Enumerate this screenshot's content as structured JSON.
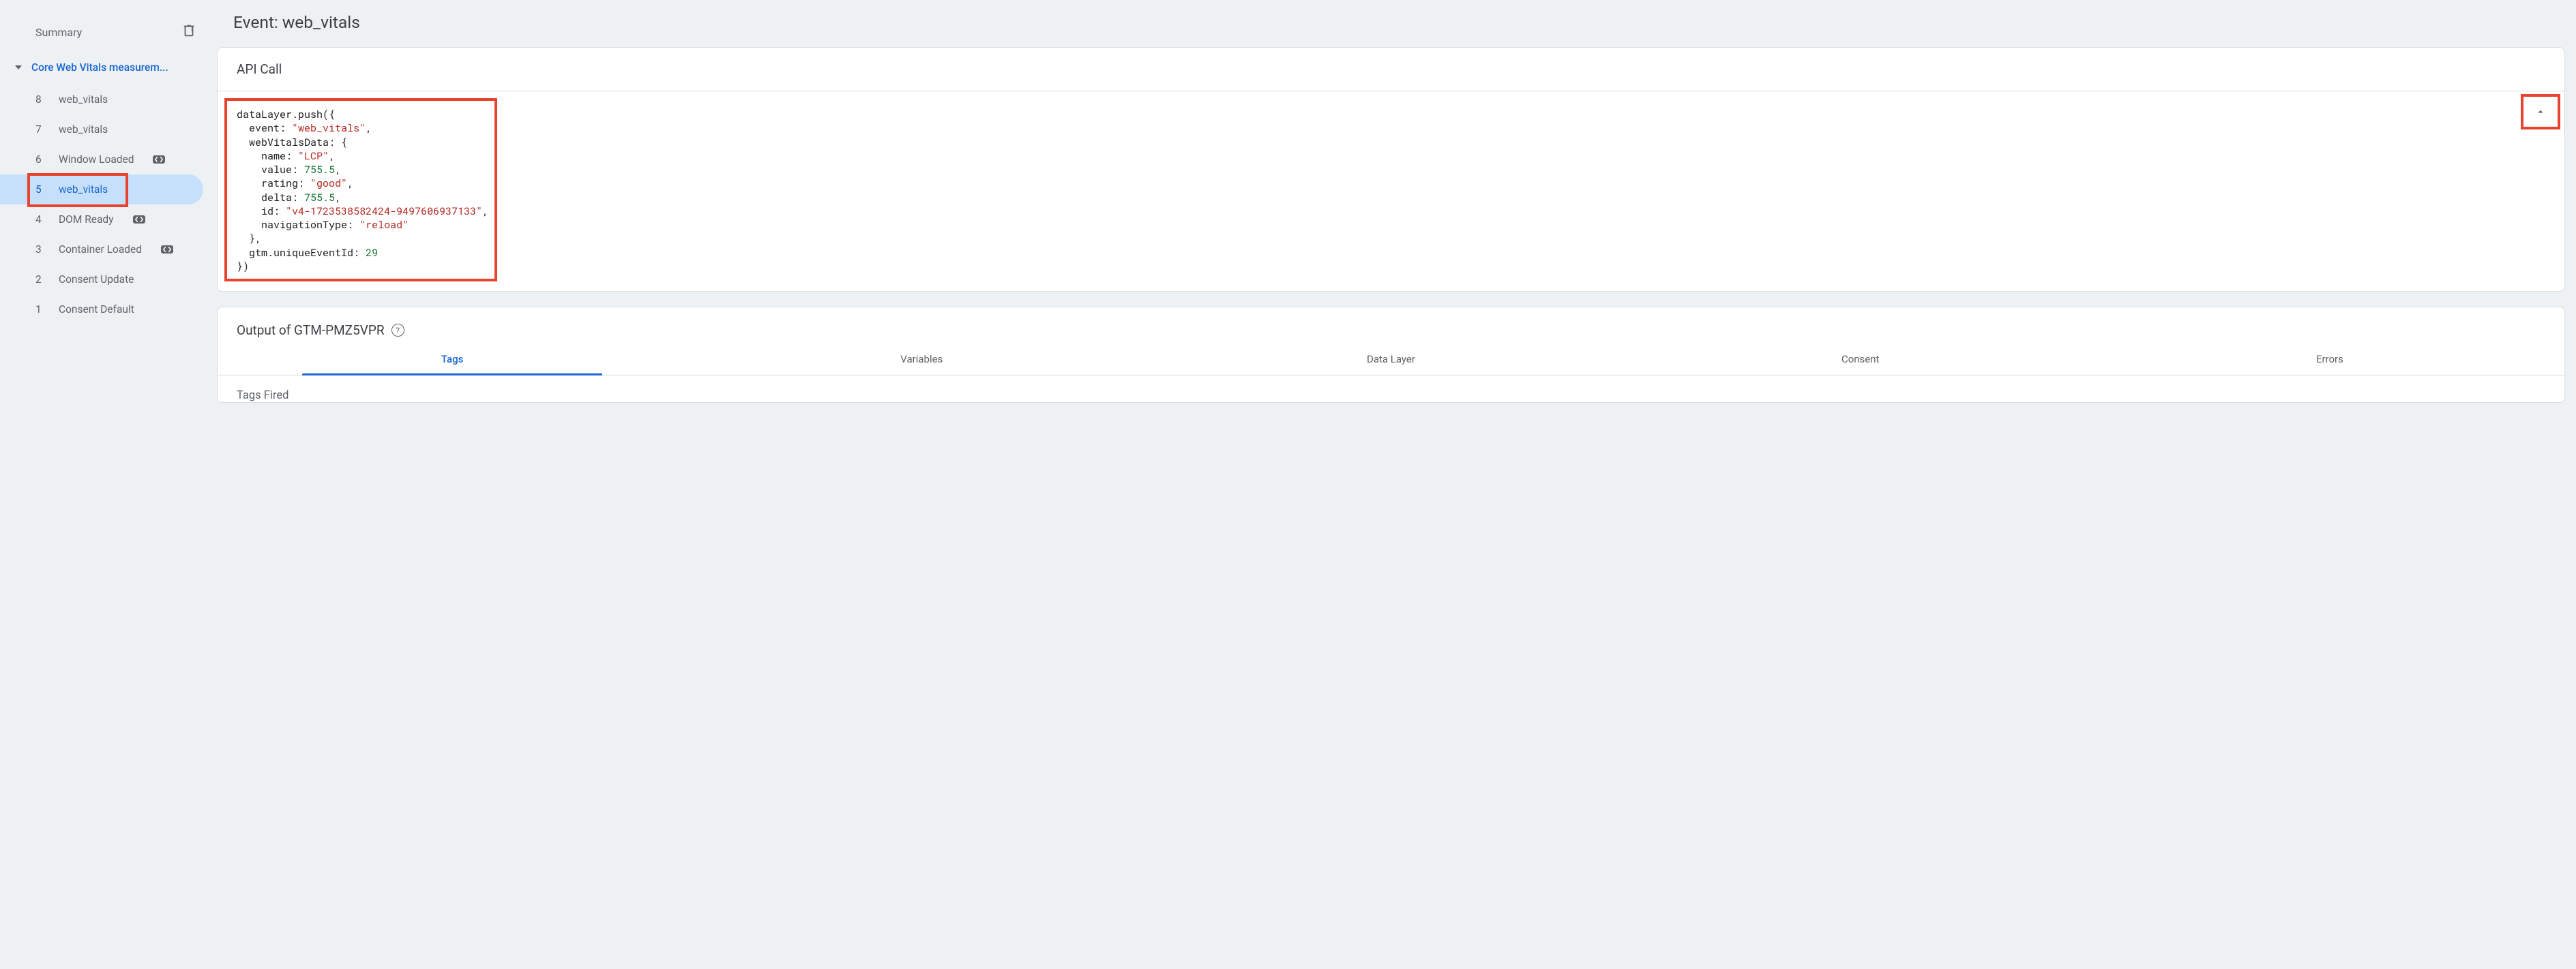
{
  "sidebar": {
    "summary_label": "Summary",
    "group_title": "Core Web Vitals measurem...",
    "items": [
      {
        "num": "8",
        "label": "web_vitals",
        "badge": false,
        "selected": false
      },
      {
        "num": "7",
        "label": "web_vitals",
        "badge": false,
        "selected": false
      },
      {
        "num": "6",
        "label": "Window Loaded",
        "badge": true,
        "selected": false
      },
      {
        "num": "5",
        "label": "web_vitals",
        "badge": false,
        "selected": true
      },
      {
        "num": "4",
        "label": "DOM Ready",
        "badge": true,
        "selected": false
      },
      {
        "num": "3",
        "label": "Container Loaded",
        "badge": true,
        "selected": false
      },
      {
        "num": "2",
        "label": "Consent Update",
        "badge": false,
        "selected": false
      },
      {
        "num": "1",
        "label": "Consent Default",
        "badge": false,
        "selected": false
      }
    ]
  },
  "event": {
    "title": "Event: web_vitals",
    "api_call_header": "API Call",
    "code": {
      "fn": "dataLayer.push",
      "event_key": "event",
      "event_val": "\"web_vitals\"",
      "wv_key": "webVitalsData",
      "name_key": "name",
      "name_val": "\"LCP\"",
      "value_key": "value",
      "value_val": "755.5",
      "rating_key": "rating",
      "rating_val": "\"good\"",
      "delta_key": "delta",
      "delta_val": "755.5",
      "id_key": "id",
      "id_val": "\"v4-1723538582424-9497606937133\"",
      "navtype_key": "navigationType",
      "navtype_val": "\"reload\"",
      "gtm_key": "gtm.uniqueEventId",
      "gtm_val": "29"
    }
  },
  "output": {
    "header": "Output of GTM-PMZ5VPR",
    "tabs": [
      "Tags",
      "Variables",
      "Data Layer",
      "Consent",
      "Errors"
    ],
    "tags_fired_label": "Tags Fired"
  }
}
